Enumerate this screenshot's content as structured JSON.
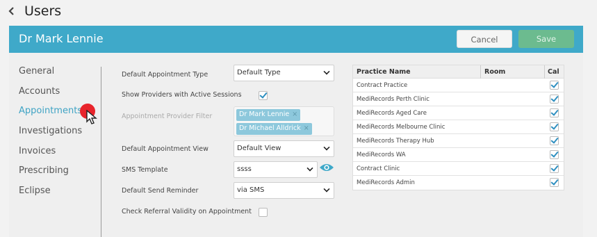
{
  "page": {
    "title": "Users",
    "back_icon": "chevron-left-icon"
  },
  "header": {
    "title": "Dr Mark Lennie",
    "cancel_label": "Cancel",
    "save_label": "Save"
  },
  "nav": {
    "items": [
      {
        "label": "General",
        "active": false
      },
      {
        "label": "Accounts",
        "active": false
      },
      {
        "label": "Appointments",
        "active": true
      },
      {
        "label": "Investigations",
        "active": false
      },
      {
        "label": "Invoices",
        "active": false
      },
      {
        "label": "Prescribing",
        "active": false
      },
      {
        "label": "Eclipse",
        "active": false
      }
    ]
  },
  "form": {
    "default_appointment_type": {
      "label": "Default Appointment Type",
      "value": "Default Type"
    },
    "show_providers": {
      "label": "Show Providers with Active Sessions",
      "checked": true
    },
    "provider_filter": {
      "label": "Appointment Provider Filter",
      "tags": [
        "Dr Mark Lennie",
        "Dr Michael Alldrick"
      ],
      "remove_glyph": "×"
    },
    "default_view": {
      "label": "Default Appointment View",
      "value": "Default View"
    },
    "sms_template": {
      "label": "SMS Template",
      "value": "ssss",
      "preview_icon": "eye-icon"
    },
    "send_reminder": {
      "label": "Default Send Reminder",
      "value": "via SMS"
    },
    "referral_validity": {
      "label": "Check Referral Validity on Appointment",
      "checked": false
    }
  },
  "practice_table": {
    "headers": {
      "name": "Practice Name",
      "room": "Room",
      "cal": "Cal"
    },
    "rows": [
      {
        "name": "Contract Practice",
        "checked": true
      },
      {
        "name": "MediRecords Perth Clinic",
        "checked": true
      },
      {
        "name": "MediRecords Aged Care",
        "checked": true
      },
      {
        "name": "MediRecords Melbourne Clinic",
        "checked": true
      },
      {
        "name": "MediRecords Therapy Hub",
        "checked": true
      },
      {
        "name": "MediRecords WA",
        "checked": true
      },
      {
        "name": "Contract Clinic",
        "checked": true
      },
      {
        "name": "MediRecords Admin",
        "checked": true
      }
    ]
  },
  "colors": {
    "accent": "#3fa9c9",
    "active_nav": "#3fa3c4",
    "save": "#6cbb8f",
    "tag": "#8dc8dc",
    "cursor_dot": "#e8242b"
  }
}
